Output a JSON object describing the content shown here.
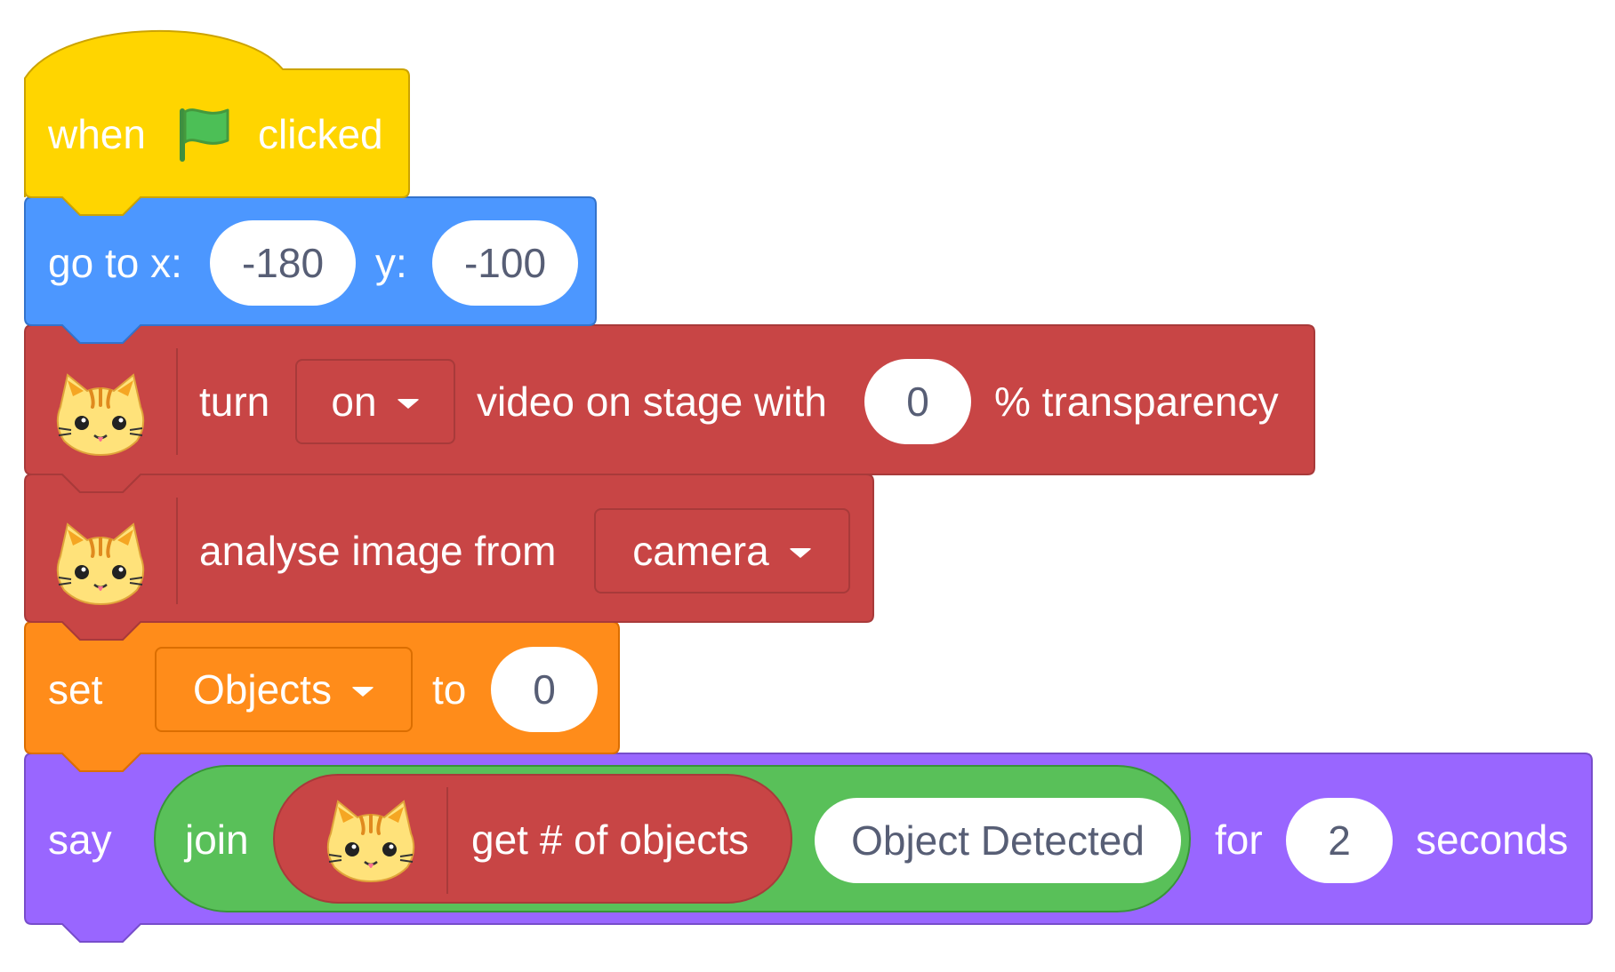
{
  "script": {
    "hat": {
      "word_when": "when",
      "word_clicked": "clicked",
      "icon": "green-flag-icon",
      "color": "#FFD500"
    },
    "goto": {
      "label": "go to x:",
      "x_value": "-180",
      "y_label": "y:",
      "y_value": "-100",
      "color": "#4C97FF"
    },
    "video": {
      "label_turn": "turn",
      "state": "on",
      "label_mid": "video on stage with",
      "transparency": "0",
      "label_end": "% transparency",
      "icon": "cat-face-icon",
      "color": "#C84545"
    },
    "analyse": {
      "label": "analyse image from",
      "source": "camera",
      "icon": "cat-face-icon",
      "color": "#C84545"
    },
    "setvar": {
      "label_set": "set",
      "variable": "Objects",
      "label_to": "to",
      "value": "0",
      "color": "#FF8C1A"
    },
    "say": {
      "label_say": "say",
      "join_label": "join",
      "reporter_label": "get # of objects",
      "join_text": "Object Detected",
      "label_for": "for",
      "seconds": "2",
      "label_seconds": "seconds",
      "color": "#9966FF",
      "join_color": "#59C059"
    }
  }
}
